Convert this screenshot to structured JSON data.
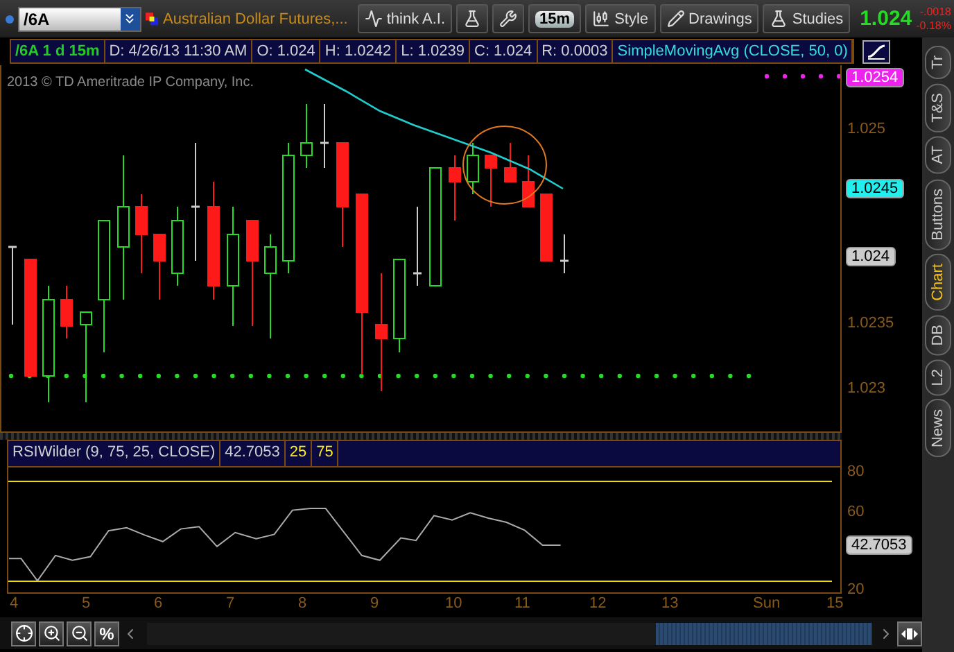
{
  "toolbar": {
    "symbol": "/6A",
    "description": "Australian Dollar Futures,...",
    "buttons": [
      {
        "kind": "ai",
        "label": "think A.I."
      },
      {
        "kind": "flask"
      },
      {
        "kind": "wrench"
      },
      {
        "kind": "period",
        "label": "15m"
      },
      {
        "kind": "style",
        "label": "Style"
      },
      {
        "kind": "drawings",
        "label": "Drawings"
      },
      {
        "kind": "studies",
        "label": "Studies"
      }
    ],
    "last_price": "1.024",
    "change": "-.0018",
    "change_pct": "-0.18%"
  },
  "info_bar": [
    {
      "text": "/6A 1 d 15m",
      "kind": "symbol"
    },
    {
      "text": "D: 4/26/13 11:30 AM",
      "kind": "field"
    },
    {
      "text": "O: 1.024",
      "kind": "field"
    },
    {
      "text": "H: 1.0242",
      "kind": "field"
    },
    {
      "text": "L: 1.0239",
      "kind": "field"
    },
    {
      "text": "C: 1.024",
      "kind": "field"
    },
    {
      "text": "R: 0.0003",
      "kind": "field"
    },
    {
      "text": "SimpleMovingAvg (CLOSE, 50, 0)",
      "kind": "study"
    }
  ],
  "chart": {
    "copyright": "2013 © TD Ameritrade IP Company, Inc.",
    "price_axis": [
      {
        "kind": "badge",
        "text": "1.0254",
        "color": "#ee22ee"
      },
      {
        "kind": "tick",
        "text": "1.025"
      },
      {
        "kind": "badge",
        "text": "1.0245",
        "color": "#22eeee"
      },
      {
        "kind": "badge",
        "text": "1.024",
        "color": "#cccccc"
      },
      {
        "kind": "tick",
        "text": "1.0235"
      },
      {
        "kind": "tick",
        "text": "1.023"
      }
    ]
  },
  "rsi": {
    "header": [
      {
        "text": "RSIWilder (9, 75, 25, CLOSE)",
        "kind": "field"
      },
      {
        "text": "42.7053",
        "kind": "field"
      },
      {
        "text": "25",
        "kind": "level"
      },
      {
        "text": "75",
        "kind": "level"
      }
    ],
    "axis": [
      {
        "kind": "tick",
        "text": "80"
      },
      {
        "kind": "tick",
        "text": "60"
      },
      {
        "kind": "badge",
        "text": "42.7053",
        "color": "#cccccc"
      },
      {
        "kind": "tick",
        "text": "20"
      }
    ]
  },
  "dates": [
    "4",
    "5",
    "6",
    "7",
    "8",
    "9",
    "10",
    "11",
    "12",
    "13",
    "Sun",
    "15"
  ],
  "side_tabs": [
    {
      "label": "Tr",
      "selected": false
    },
    {
      "label": "T&S",
      "selected": false
    },
    {
      "label": "AT",
      "selected": false
    },
    {
      "label": "Buttons",
      "selected": false
    },
    {
      "label": "Chart",
      "selected": true
    },
    {
      "label": "DB",
      "selected": false
    },
    {
      "label": "L2",
      "selected": false
    },
    {
      "label": "News",
      "selected": false
    }
  ],
  "bottom_bar": {
    "percent_button": "%"
  }
}
